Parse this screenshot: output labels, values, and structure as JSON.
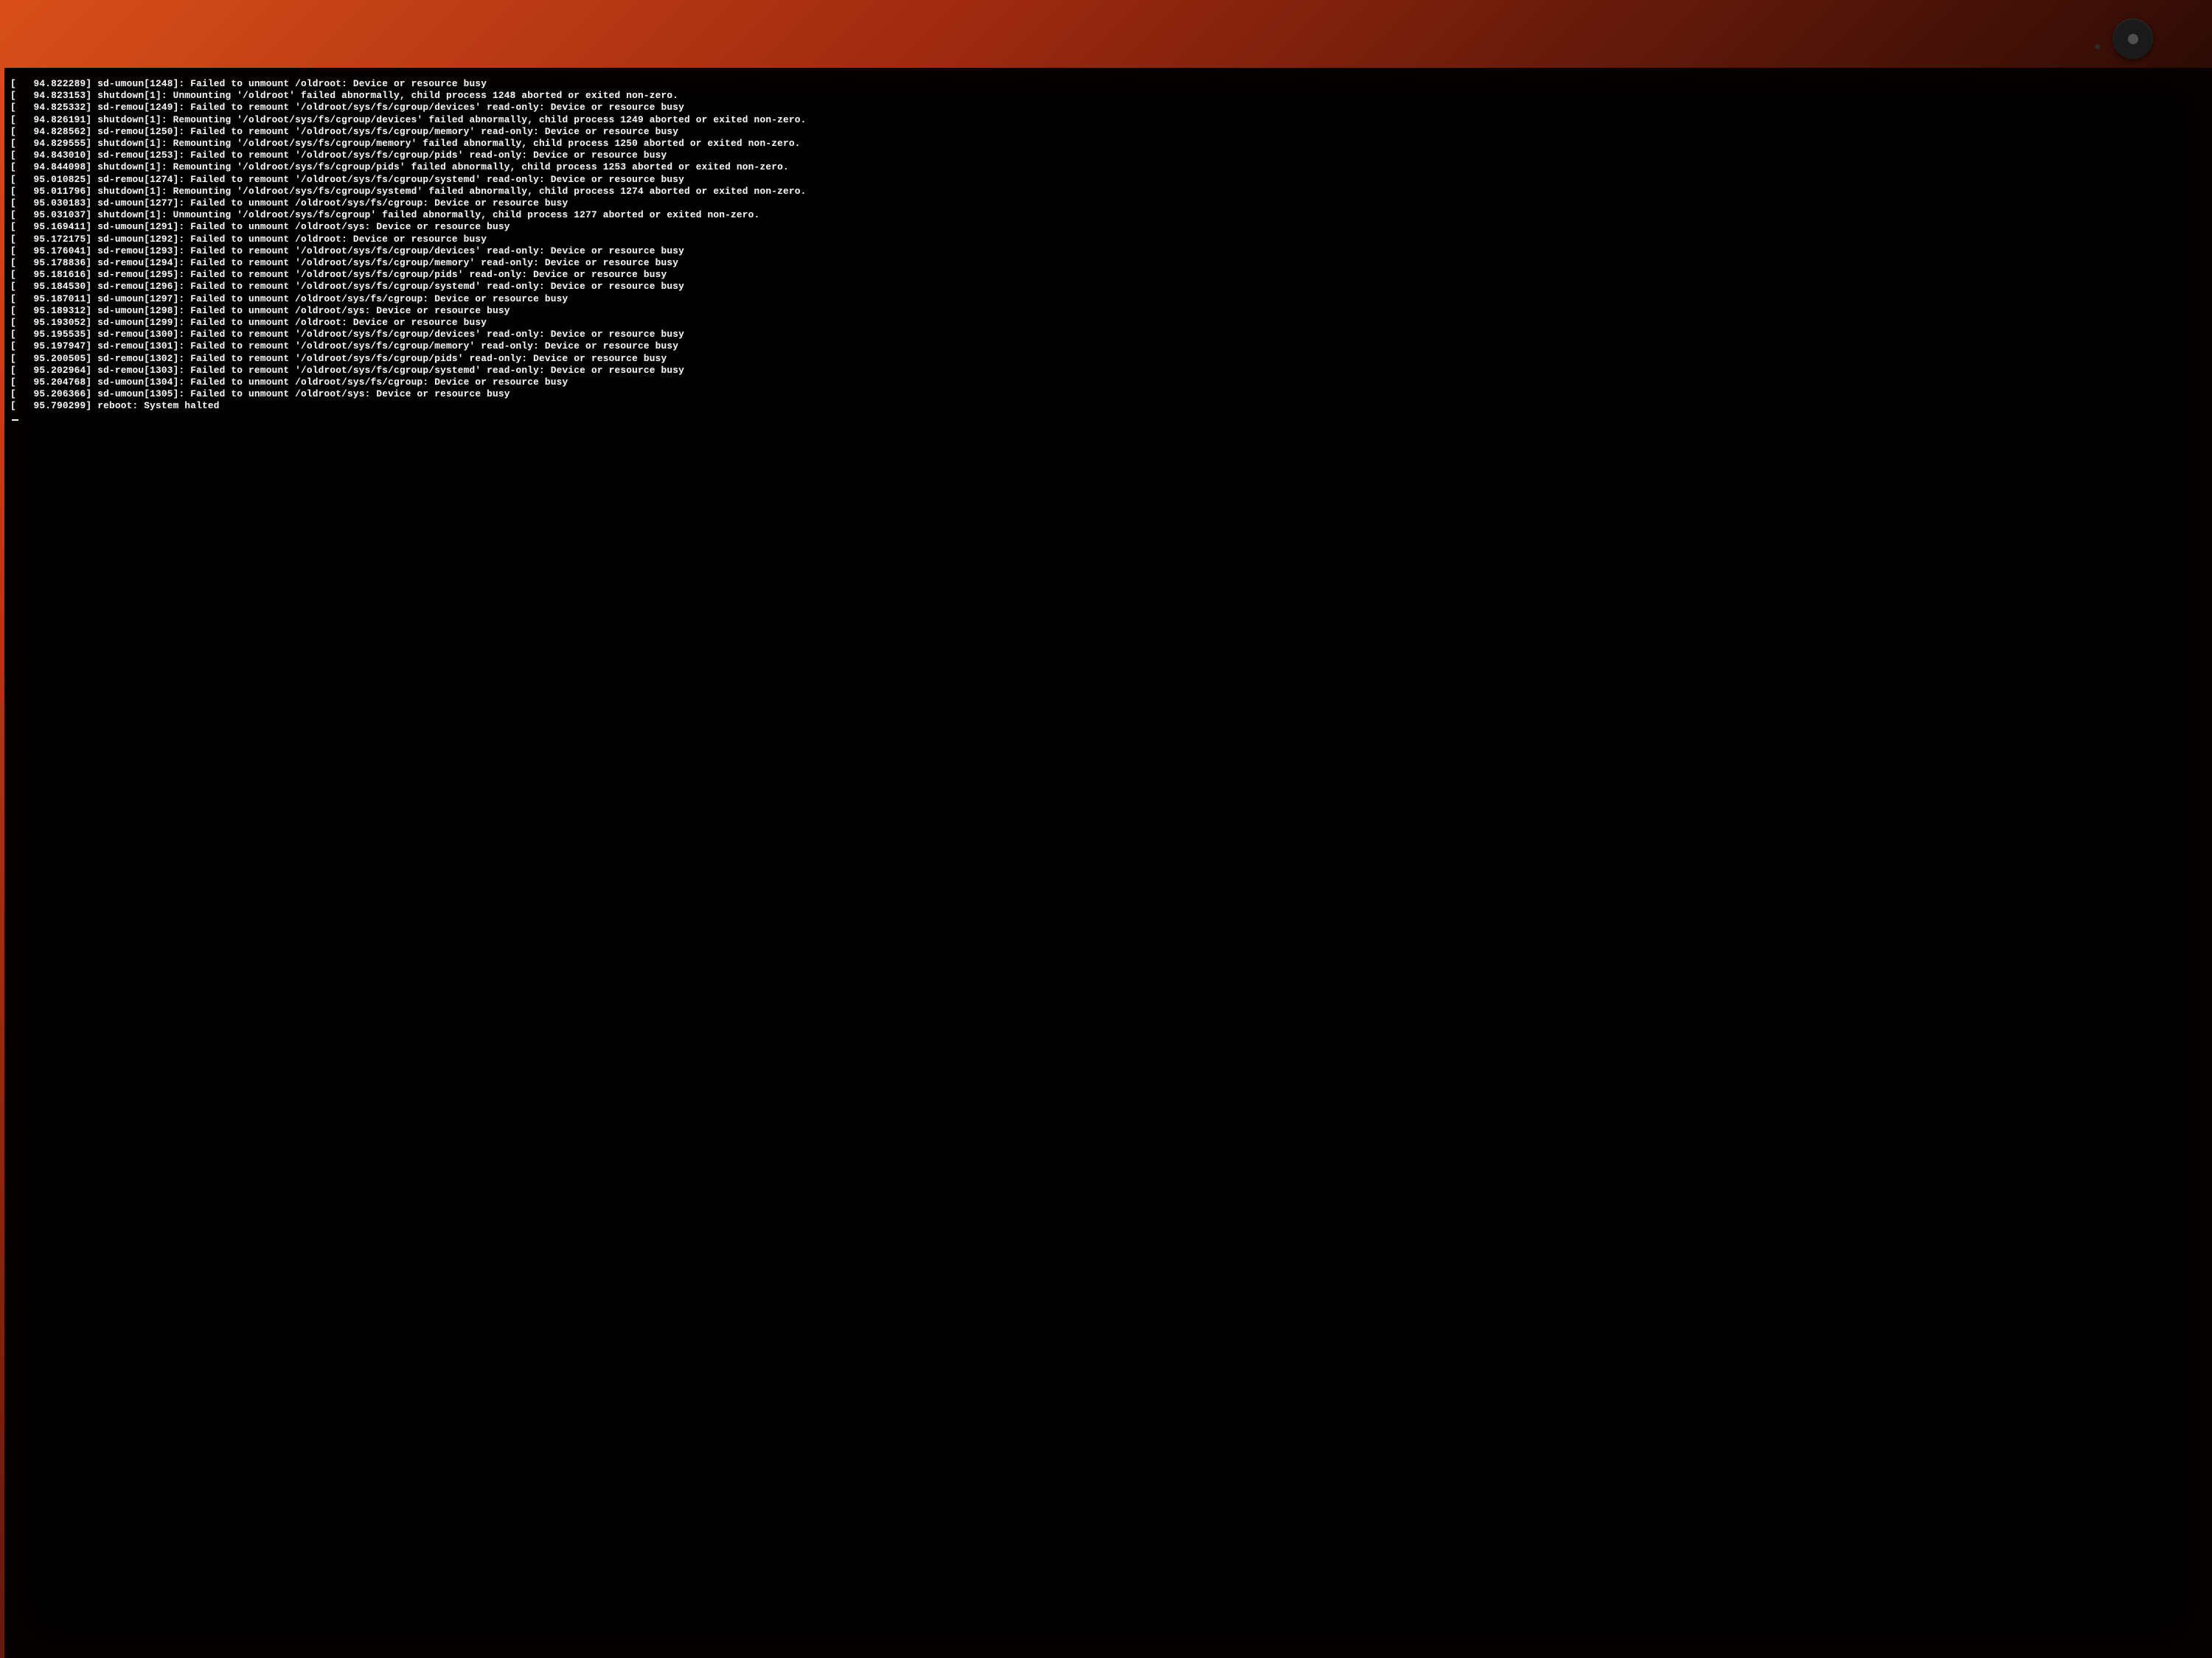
{
  "log_lines": [
    "[   94.822289] sd-umoun[1248]: Failed to unmount /oldroot: Device or resource busy",
    "[   94.823153] shutdown[1]: Unmounting '/oldroot' failed abnormally, child process 1248 aborted or exited non-zero.",
    "[   94.825332] sd-remou[1249]: Failed to remount '/oldroot/sys/fs/cgroup/devices' read-only: Device or resource busy",
    "[   94.826191] shutdown[1]: Remounting '/oldroot/sys/fs/cgroup/devices' failed abnormally, child process 1249 aborted or exited non-zero.",
    "[   94.828562] sd-remou[1250]: Failed to remount '/oldroot/sys/fs/cgroup/memory' read-only: Device or resource busy",
    "[   94.829555] shutdown[1]: Remounting '/oldroot/sys/fs/cgroup/memory' failed abnormally, child process 1250 aborted or exited non-zero.",
    "[   94.843010] sd-remou[1253]: Failed to remount '/oldroot/sys/fs/cgroup/pids' read-only: Device or resource busy",
    "[   94.844098] shutdown[1]: Remounting '/oldroot/sys/fs/cgroup/pids' failed abnormally, child process 1253 aborted or exited non-zero.",
    "[   95.010825] sd-remou[1274]: Failed to remount '/oldroot/sys/fs/cgroup/systemd' read-only: Device or resource busy",
    "[   95.011796] shutdown[1]: Remounting '/oldroot/sys/fs/cgroup/systemd' failed abnormally, child process 1274 aborted or exited non-zero.",
    "[   95.030183] sd-umoun[1277]: Failed to unmount /oldroot/sys/fs/cgroup: Device or resource busy",
    "[   95.031037] shutdown[1]: Unmounting '/oldroot/sys/fs/cgroup' failed abnormally, child process 1277 aborted or exited non-zero.",
    "[   95.169411] sd-umoun[1291]: Failed to unmount /oldroot/sys: Device or resource busy",
    "[   95.172175] sd-umoun[1292]: Failed to unmount /oldroot: Device or resource busy",
    "[   95.176041] sd-remou[1293]: Failed to remount '/oldroot/sys/fs/cgroup/devices' read-only: Device or resource busy",
    "[   95.178836] sd-remou[1294]: Failed to remount '/oldroot/sys/fs/cgroup/memory' read-only: Device or resource busy",
    "[   95.181616] sd-remou[1295]: Failed to remount '/oldroot/sys/fs/cgroup/pids' read-only: Device or resource busy",
    "[   95.184530] sd-remou[1296]: Failed to remount '/oldroot/sys/fs/cgroup/systemd' read-only: Device or resource busy",
    "[   95.187011] sd-umoun[1297]: Failed to unmount /oldroot/sys/fs/cgroup: Device or resource busy",
    "[   95.189312] sd-umoun[1298]: Failed to unmount /oldroot/sys: Device or resource busy",
    "[   95.193052] sd-umoun[1299]: Failed to unmount /oldroot: Device or resource busy",
    "[   95.195535] sd-remou[1300]: Failed to remount '/oldroot/sys/fs/cgroup/devices' read-only: Device or resource busy",
    "[   95.197947] sd-remou[1301]: Failed to remount '/oldroot/sys/fs/cgroup/memory' read-only: Device or resource busy",
    "[   95.200505] sd-remou[1302]: Failed to remount '/oldroot/sys/fs/cgroup/pids' read-only: Device or resource busy",
    "[   95.202964] sd-remou[1303]: Failed to remount '/oldroot/sys/fs/cgroup/systemd' read-only: Device or resource busy",
    "[   95.204768] sd-umoun[1304]: Failed to unmount /oldroot/sys/fs/cgroup: Device or resource busy",
    "[   95.206366] sd-umoun[1305]: Failed to unmount /oldroot/sys: Device or resource busy",
    "[   95.790299] reboot: System halted"
  ]
}
